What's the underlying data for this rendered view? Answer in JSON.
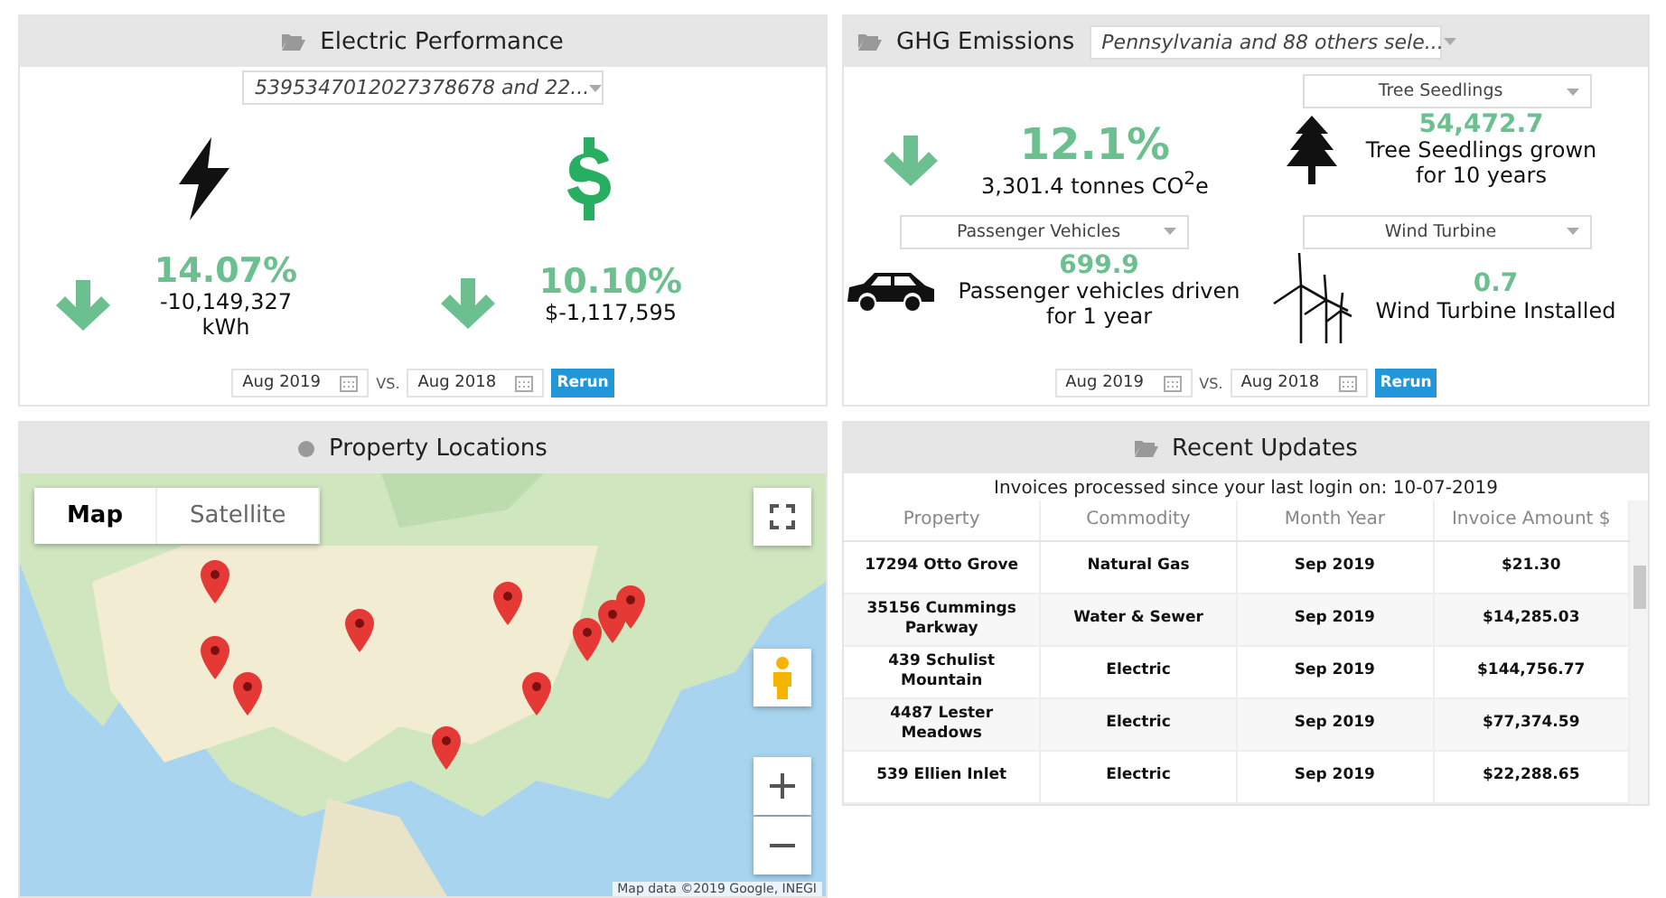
{
  "electric": {
    "title": "Electric Performance",
    "selector": "5395347012027378678 and 22...",
    "metrics": [
      {
        "kind": "energy",
        "percent": "14.07%",
        "value": "-10,149,327 kWh"
      },
      {
        "kind": "cost",
        "percent": "10.10%",
        "value": "$-1,117,595"
      }
    ],
    "date_from": "Aug 2019",
    "vs": "VS.",
    "date_to": "Aug 2018",
    "rerun": "Rerun"
  },
  "ghg": {
    "title": "GHG Emissions",
    "selector": "Pennsylvania and 88 others sele...",
    "main": {
      "percent": "12.1%",
      "value": "3,301.4 tonnes CO$^{2}$e"
    },
    "equivalents": [
      {
        "kind": "tree",
        "option": "Tree Seedlings",
        "value": "54,472.7",
        "caption": "Tree Seedlings grown for 10 years"
      },
      {
        "kind": "car",
        "option": "Passenger Vehicles",
        "value": "699.9",
        "caption": "Passenger vehicles driven for 1 year"
      },
      {
        "kind": "turbine",
        "option": "Wind Turbine",
        "value": "0.7",
        "caption": "Wind Turbine Installed"
      }
    ],
    "date_from": "Aug 2019",
    "vs": "VS.",
    "date_to": "Aug 2018",
    "rerun": "Rerun"
  },
  "locations": {
    "title": "Property Locations",
    "map_types": [
      {
        "label": "Map",
        "selected": true
      },
      {
        "label": "Satellite",
        "selected": false
      }
    ],
    "attribution": "Map data ©2019 Google, INEGI"
  },
  "updates": {
    "title": "Recent Updates",
    "subtitle": "Invoices processed since your last login on: 10-07-2019",
    "columns": [
      "Property",
      "Commodity",
      "Month Year",
      "Invoice Amount $"
    ],
    "rows": [
      [
        "17294 Otto Grove",
        "Natural Gas",
        "Sep 2019",
        "$21.30"
      ],
      [
        "35156 Cummings Parkway",
        "Water & Sewer",
        "Sep 2019",
        "$14,285.03"
      ],
      [
        "439 Schulist Mountain",
        "Electric",
        "Sep 2019",
        "$144,756.77"
      ],
      [
        "4487 Lester Meadows",
        "Electric",
        "Sep 2019",
        "$77,374.59"
      ],
      [
        "539 Ellien Inlet",
        "Electric",
        "Sep 2019",
        "$22,288.65"
      ]
    ]
  }
}
